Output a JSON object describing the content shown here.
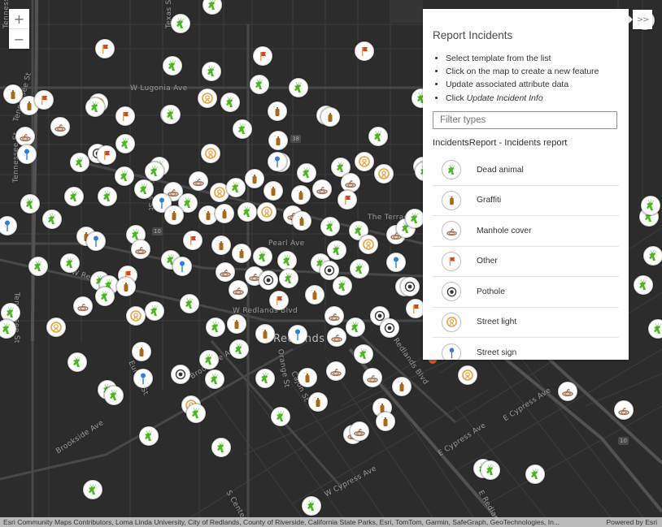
{
  "map": {
    "street_labels": [
      {
        "text": "Tennessee St",
        "rot": -90
      },
      {
        "text": "Texas St",
        "rot": -90
      },
      {
        "text": "W Lugonia Ave",
        "rot": 0
      },
      {
        "text": "Tennessee St",
        "rot": -75
      },
      {
        "text": "Tennessee St",
        "rot": -90
      },
      {
        "text": "Texas St",
        "rot": 90
      },
      {
        "text": "W Redlands Blvd",
        "rot": 18
      },
      {
        "text": "Pearl Ave",
        "rot": 0
      },
      {
        "text": "The Terrace",
        "rot": 0
      },
      {
        "text": "Orange St",
        "rot": 80
      },
      {
        "text": "W Redlands Blvd",
        "rot": 0
      },
      {
        "text": "E Redlands Blvd",
        "rot": 55
      },
      {
        "text": "Tennessee St",
        "rot": 90
      },
      {
        "text": "Eureka St",
        "rot": 65
      },
      {
        "text": "Brookside Ave",
        "rot": -33
      },
      {
        "text": "Brookside Ave",
        "rot": -33
      },
      {
        "text": "Cajon St",
        "rot": 65
      },
      {
        "text": "E Cypress Ave",
        "rot": -33
      },
      {
        "text": "E Cypress Ave",
        "rot": -33
      },
      {
        "text": "W Cypress Ave",
        "rot": -28
      },
      {
        "text": "E Redlands",
        "rot": 60
      },
      {
        "text": "S Center St",
        "rot": 60
      }
    ],
    "city_label": "Redlands",
    "shields": [
      "38",
      "10",
      "10"
    ],
    "marker_types": [
      "dead-animal",
      "graffiti",
      "manhole-cover",
      "other",
      "pothole",
      "street-light",
      "street-sign"
    ]
  },
  "zoom": {
    "in_label": "+",
    "out_label": "−"
  },
  "panel": {
    "title": "Report Incidents",
    "steps": [
      {
        "text": "Select template from the list"
      },
      {
        "text": "Click on the map to create a new feature"
      },
      {
        "text": "Update associated attribute data"
      },
      {
        "text": "Click ",
        "em": "Update Incident Info"
      }
    ],
    "filter_placeholder": "Filter types",
    "group_title": "IncidentsReport - Incidents report",
    "templates": [
      {
        "label": "Dead animal",
        "icon": "dead-animal"
      },
      {
        "label": "Graffiti",
        "icon": "graffiti"
      },
      {
        "label": "Manhole cover",
        "icon": "manhole-cover"
      },
      {
        "label": "Other",
        "icon": "other"
      },
      {
        "label": "Pothole",
        "icon": "pothole"
      },
      {
        "label": "Street light",
        "icon": "street-light"
      },
      {
        "label": "Street sign",
        "icon": "street-sign"
      }
    ],
    "collapse_label": ">>"
  },
  "colors": {
    "map_bg": "#2c2c2c",
    "dead_animal": "#4cb521",
    "graffiti": "#a8691b",
    "manhole": "#a0735a",
    "other_flag": "#d8441c",
    "pothole": "#333333",
    "street_light": "#e8a33a",
    "street_sign": "#2f7ee0"
  },
  "attribution": {
    "text": "Esri Community Maps Contributors, Loma Linda University, City of Redlands, County of Riverside, California State Parks, Esri, TomTom, Garmin, SafeGraph, GeoTechnologies, In...",
    "powered_by": "Powered by Esri"
  }
}
